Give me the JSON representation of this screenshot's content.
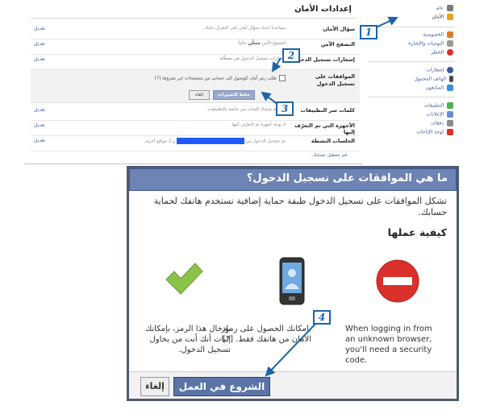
{
  "settings": {
    "title": "إعدادات الأمان",
    "edit_label": "تعديل",
    "rows": [
      {
        "label": "سؤال الأمان",
        "value": "يساعدنا إعداد سؤال أمان على التعرف عليك."
      },
      {
        "label": "التصفح الآمن",
        "value_prefix": "التصفح الآمن ",
        "value_bold": "ممكّن",
        "value_suffix": " حالياً."
      },
      {
        "label": "إشعارات تسجيل الدخول",
        "value": "إشعارات تسجيل الدخول هي معطّلة."
      }
    ],
    "approvals": {
      "label": "الموافقات على تسجيل الدخول",
      "checkbox_text": "طلب رمز أمان للوصول إلى حسابي من متصفحات غير معروفة",
      "help": "[?]",
      "save": "حفظ التغييرات",
      "cancel": "إلغاء"
    },
    "rows2": [
      {
        "label": "كلمات سر التطبيقات",
        "value": "لم تقم بإنشاء كلمات سر خاصة بالتطبيقات."
      },
      {
        "label": "الأجهزة التي تم التعرّف إليها",
        "value": "لا يوجد أجهزة تم التعرّف إليها."
      },
      {
        "label": "الجلسات النشطة",
        "value_prefix": "تم تسجيل الدخول من",
        "value_suffix": "و 2 مواقع أخرى."
      }
    ],
    "footnote": "قم بتعطيل حسابك."
  },
  "sidebar": {
    "items": [
      {
        "label": "عام",
        "icon": "gear-icon",
        "color": "#7a7a7a"
      },
      {
        "label": "الأمان",
        "icon": "shield-icon",
        "color": "#e8a422"
      },
      {
        "label": "الخصوصية",
        "icon": "lock-icon",
        "color": "#d87d2b"
      },
      {
        "label": "اليوميات والإشارة",
        "icon": "timeline-icon",
        "color": "#9a9a9a"
      },
      {
        "label": "الحظر",
        "icon": "block-icon",
        "color": "#d9302c"
      },
      {
        "label": "إشعارات",
        "icon": "globe-icon",
        "color": "#3b5998"
      },
      {
        "label": "الهاتف المحمول",
        "icon": "mobile-icon",
        "color": "#4a4a4a"
      },
      {
        "label": "المتابعون",
        "icon": "rss-icon",
        "color": "#3b8fd9"
      },
      {
        "label": "التطبيقات",
        "icon": "apps-icon",
        "color": "#4caf50"
      },
      {
        "label": "الإعلانات",
        "icon": "ads-icon",
        "color": "#6b8ccf"
      },
      {
        "label": "دفعات",
        "icon": "payments-icon",
        "color": "#8a8a8a"
      },
      {
        "label": "لوحة الإتاحات",
        "icon": "support-icon",
        "color": "#d9302c"
      }
    ]
  },
  "markers": [
    "1",
    "2",
    "3",
    "4"
  ],
  "dialog": {
    "title": "ما هي الموافقات على تسجيل الدخول؟",
    "intro": "تشكل الموافقات على تسجيل الدخول طبقة حماية إضافية تستخدم هاتفك لحماية حسابك.",
    "howto": "كيفية عملها",
    "col_stop": "When logging in from an unknown browser, you'll need a security code.",
    "col_phone": "بإمكانك الحصول على رموز الأمان من هاتفك فقط. [?]",
    "col_check": "بإدخال هذا الرمز، بإمكانك إثبات أنك أنت من يحاول تسجيل الدخول.",
    "start": "الشروع في العمل",
    "cancel": "إلغاء"
  },
  "colors": {
    "accent": "#3b5998",
    "marker": "#1d63a8",
    "check": "#8bc34a",
    "stop": "#d9302c"
  }
}
